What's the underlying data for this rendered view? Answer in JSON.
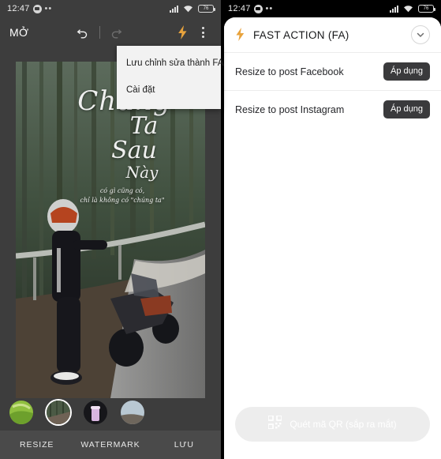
{
  "left": {
    "status": {
      "time": "12:47",
      "chat_icon": "chat-bubble-icon",
      "more_icon": "ellipsis-icon",
      "signal_icon": "signal-bars-icon",
      "wifi_icon": "wifi-icon",
      "battery_icon": "battery-icon",
      "battery_text": "76"
    },
    "toolbar": {
      "open_label": "MỞ",
      "undo_icon": "undo-arrow-icon",
      "redo_icon": "redo-arrow-icon",
      "fast_action_icon": "lightning-bolt-icon",
      "overflow_icon": "kebab-menu-icon"
    },
    "menu": {
      "items": [
        {
          "label": "Lưu chỉnh sửa thành FA"
        },
        {
          "label": "Cài đặt"
        }
      ]
    },
    "canvas": {
      "caption_line1": "Chúng",
      "caption_line2": "Ta",
      "caption_line3": "Sau",
      "caption_line4": "Này",
      "caption_sub1": "có gì cũng có,",
      "caption_sub2": "chỉ là không có \"chúng ta\""
    },
    "thumbnails": [
      {
        "name": "filter-thumb-green",
        "selected": false
      },
      {
        "name": "filter-thumb-original",
        "selected": true
      },
      {
        "name": "filter-thumb-purple",
        "selected": false
      },
      {
        "name": "filter-thumb-sky",
        "selected": false
      }
    ],
    "tabs": [
      {
        "label": "RESIZE"
      },
      {
        "label": "WATERMARK"
      },
      {
        "label": "LƯU"
      }
    ]
  },
  "right": {
    "status": {
      "time": "12:47",
      "chat_icon": "chat-bubble-icon",
      "more_icon": "ellipsis-icon",
      "signal_icon": "signal-bars-icon",
      "wifi_icon": "wifi-icon",
      "battery_icon": "battery-icon",
      "battery_text": "76"
    },
    "sheet": {
      "bolt_icon": "lightning-bolt-icon",
      "title": "FAST ACTION (FA)",
      "collapse_icon": "chevron-down-icon",
      "rows": [
        {
          "label": "Resize to post Facebook",
          "button": "Áp dụng"
        },
        {
          "label": "Resize to post Instagram",
          "button": "Áp dụng"
        }
      ],
      "qr_button": {
        "icon": "qr-code-icon",
        "label": "Quét mã QR (sắp ra mắt)"
      }
    }
  },
  "colors": {
    "accent_bolt": "#E8A33D",
    "left_chrome": "#3D3D3D",
    "left_tabbar": "#4A4A4A",
    "apply_button": "#3A3A3C",
    "qr_disabled": "#EDEDED"
  }
}
